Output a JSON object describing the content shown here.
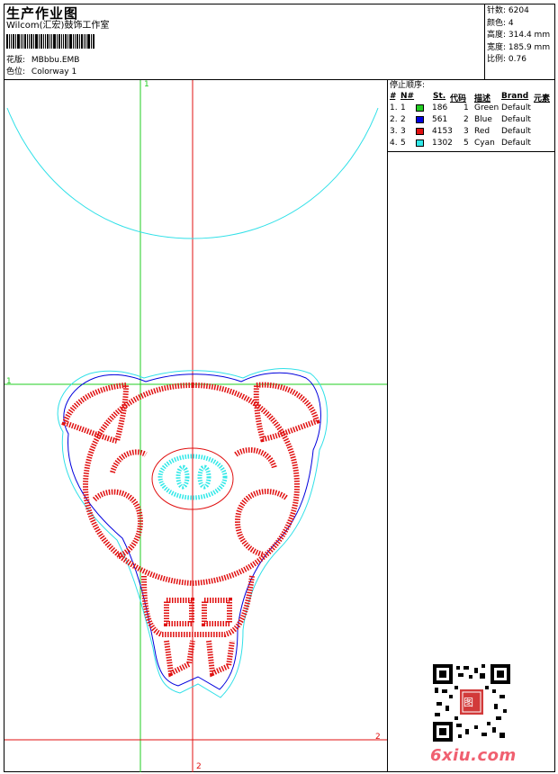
{
  "header": {
    "title": "生产作业图",
    "company": "Wilcom(汇宏)鼓饰工作室",
    "design_label": "花版:",
    "design_value": "MBbbu.EMB",
    "colorway_label": "色位:",
    "colorway_value": "Colorway 1"
  },
  "stats": {
    "stitches_label": "针数:",
    "stitches_value": "6204",
    "colors_label": "颜色:",
    "colors_value": "4",
    "height_label": "高度:",
    "height_value": "314.4 mm",
    "width_label": "宽度:",
    "width_value": "185.9 mm",
    "scale_label": "比例:",
    "scale_value": "0.76"
  },
  "sequence": {
    "title": "停止顺序:",
    "columns": [
      "#",
      "N#",
      "St.",
      "代码",
      "描述",
      "Brand",
      "元素"
    ],
    "rows": [
      {
        "idx": "1.",
        "n": "1",
        "color": "#22cc22",
        "st": "186",
        "code": "1",
        "desc": "Green",
        "brand": "Default"
      },
      {
        "idx": "2.",
        "n": "2",
        "color": "#0000dd",
        "st": "561",
        "code": "2",
        "desc": "Blue",
        "brand": "Default"
      },
      {
        "idx": "3.",
        "n": "3",
        "color": "#e01010",
        "st": "4153",
        "code": "3",
        "desc": "Red",
        "brand": "Default"
      },
      {
        "idx": "4.",
        "n": "5",
        "color": "#30e8e8",
        "st": "1302",
        "code": "5",
        "desc": "Cyan",
        "brand": "Default"
      }
    ]
  },
  "guides": {
    "green_v_label": "1",
    "green_h_label": "1",
    "red_h_label": "2",
    "red_v_label": "2"
  },
  "colors": {
    "green": "#22cc22",
    "red": "#e01010",
    "blue": "#0000dd",
    "cyan": "#30e0e8",
    "logo": "#f06070"
  },
  "watermark": {
    "text": "6xiu.com",
    "stamp": "图"
  }
}
